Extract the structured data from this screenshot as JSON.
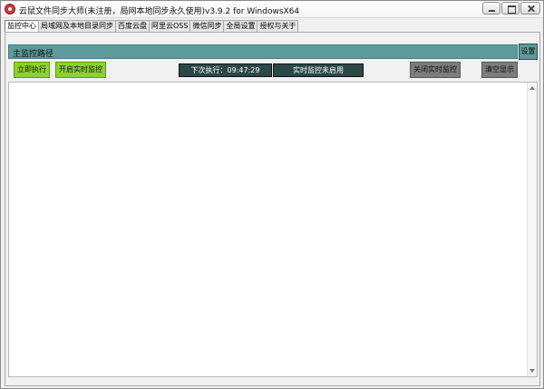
{
  "window": {
    "title": "云鼠文件同步大师(未注册，局网本地同步永久使用)v3.9.2 for WindowsX64",
    "icon": "app-logo-icon"
  },
  "tabs": [
    {
      "label": "监控中心",
      "active": true
    },
    {
      "label": "局域网及本地目录同步",
      "active": false
    },
    {
      "label": "百度云盘",
      "active": false
    },
    {
      "label": "阿里云OSS",
      "active": false
    },
    {
      "label": "微信同步",
      "active": false
    },
    {
      "label": "全局设置",
      "active": false
    },
    {
      "label": "授权与关于",
      "active": false
    }
  ],
  "main": {
    "section_title": "主监控路径",
    "settings_label": "设置",
    "buttons": {
      "run_now": "立即执行",
      "start_realtime": "开启实时监控",
      "stop_realtime": "关闭实时监控",
      "clear_display": "清空显示"
    },
    "status": {
      "next_run": "下次执行：09:47:29",
      "realtime_state": "实时监控未启用"
    }
  },
  "colors": {
    "section_bar": "#5d9a9a",
    "green_button": "#8bd22f",
    "gray_button": "#7d7d7d",
    "status_box": "#2b4848"
  }
}
